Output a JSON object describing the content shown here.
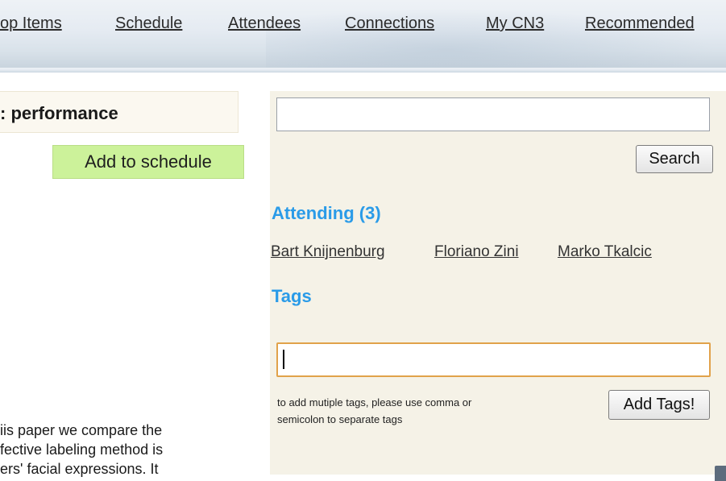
{
  "nav": {
    "items": [
      {
        "label": "op Items"
      },
      {
        "label": "Schedule"
      },
      {
        "label": "Attendees"
      },
      {
        "label": "Connections"
      },
      {
        "label": "My CN3"
      },
      {
        "label": "Recommended"
      }
    ]
  },
  "paper": {
    "title": ": performance",
    "add_to_schedule": "Add to schedule",
    "abstract_lines": [
      "iis paper we compare the",
      "fective labeling method is",
      "ers' facial expressions. It"
    ]
  },
  "sidebar": {
    "search": {
      "value": "",
      "placeholder": "",
      "button_label": "Search"
    },
    "attending": {
      "heading": "Attending (3)",
      "people": [
        "Bart Knijnenburg",
        "Floriano Zini",
        "Marko Tkalcic"
      ]
    },
    "tags": {
      "heading": "Tags",
      "input_value": "",
      "hint_lines": [
        "to add mutiple tags, please use comma or",
        "semicolon to separate tags"
      ],
      "button_label": "Add Tags!"
    }
  },
  "colors": {
    "heading_blue": "#2a9be8",
    "add_button_green": "#ccf29a",
    "panel_bg": "#f5f2e7",
    "focus_orange": "#e1a24a"
  }
}
